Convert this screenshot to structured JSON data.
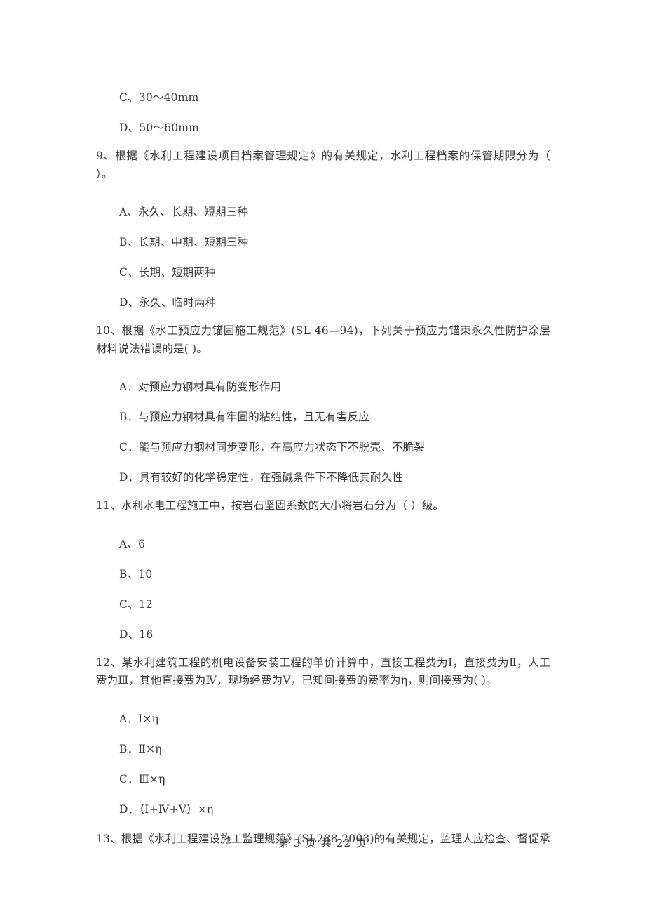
{
  "document": {
    "type": "exam-paper",
    "language": "zh-CN",
    "page_background": "#ffffff",
    "text_color": "#3a3a3a"
  },
  "body": {
    "orphan_options": {
      "note": "options continuing from the previous page question",
      "items": [
        "C、30～40mm",
        "D、50～60mm"
      ]
    },
    "questions": [
      {
        "number": "9",
        "stem": "9、根据《水利工程建设项目档案管理规定》的有关规定，水利工程档案的保管期限分为（    ）。",
        "options": [
          "A、永久、长期、短期三种",
          "B、长期、中期、短期三种",
          "C、长期、短期两种",
          "D、永久、临时两种"
        ]
      },
      {
        "number": "10",
        "stem": "10、根据《水工预应力锚固施工规范》(SL 46—94)，下列关于预应力锚束永久性防护涂层材料说法错误的是(    )。",
        "options": [
          "A．对预应力钢材具有防变形作用",
          "B．与预应力钢材具有牢固的粘结性，且无有害反应",
          "C．能与预应力钢材同步变形，在高应力状态下不脱壳、不脆裂",
          "D．具有较好的化学稳定性，在强碱条件下不降低其耐久性"
        ]
      },
      {
        "number": "11",
        "stem": "11、水利水电工程施工中，按岩石坚固系数的大小将岩石分为（    ）级。",
        "options": [
          "A、6",
          "B、10",
          "C、12",
          "D、16"
        ]
      },
      {
        "number": "12",
        "stem": "12、某水利建筑工程的机电设备安装工程的单价计算中，直接工程费为Ⅰ，直接费为Ⅱ，人工费为Ⅲ，其他直接费为Ⅳ，现场经费为Ⅴ，已知间接费的费率为η，则间接费为(    )。",
        "options": [
          "A．Ⅰ×η",
          "B．Ⅱ×η",
          "C．Ⅲ×η",
          "D．（Ⅰ+Ⅳ+Ⅴ）×η"
        ]
      },
      {
        "number": "13",
        "stem": "13、根据《水利工程建设施工监理规范》(SL288-2003)的有关规定，监理人应检查、督促承",
        "options": []
      }
    ]
  },
  "footer": {
    "page_label": "第 3 页 共 22 页",
    "current_page": "3",
    "total_pages": "22"
  }
}
